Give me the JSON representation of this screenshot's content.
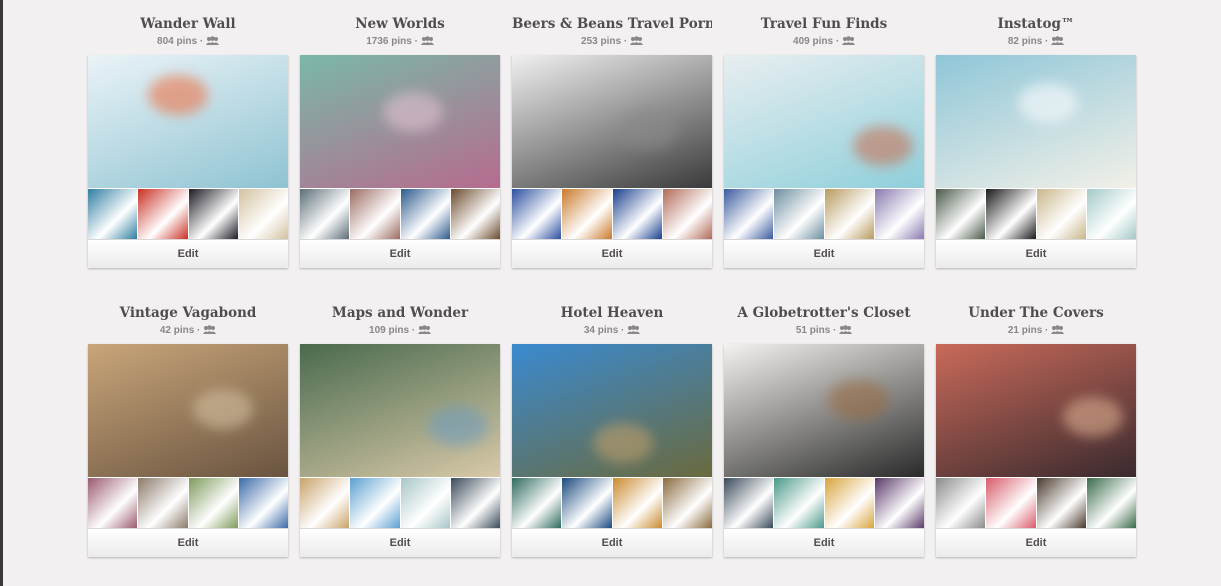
{
  "edit_label": "Edit",
  "boards": [
    {
      "title": "Wander Wall",
      "pins": "804 pins",
      "cover": [
        "#eaf3f7",
        "#8fc3d2"
      ],
      "accent": "#f06a3a",
      "thumbs": [
        "#2f7ea1",
        "#c93024",
        "#1d1a24",
        "#d3c1a0"
      ]
    },
    {
      "title": "New Worlds",
      "pins": "1736 pins",
      "cover": [
        "#7ab8a8",
        "#b66b8e"
      ],
      "accent": "#e7c6d6",
      "thumbs": [
        "#5d6e78",
        "#9c6b61",
        "#2d5a8e",
        "#6c4b2e"
      ]
    },
    {
      "title": "Beers & Beans Travel Porn",
      "pins": "253 pins",
      "cover": [
        "#f0f0f0",
        "#3a3a3a"
      ],
      "accent": "#8a8a8a",
      "thumbs": [
        "#2b4fa0",
        "#c97a2a",
        "#1a3f8e",
        "#b26a58"
      ]
    },
    {
      "title": "Travel Fun Finds",
      "pins": "409 pins",
      "cover": [
        "#e8eef0",
        "#8fcfdb"
      ],
      "accent": "#c96a4a",
      "thumbs": [
        "#3a5a9e",
        "#6c8ea0",
        "#b89a5e",
        "#8a7ab0"
      ]
    },
    {
      "title": "Instatog™",
      "pins": "82 pins",
      "cover": [
        "#8fc6d8",
        "#f2f0e8"
      ],
      "accent": "#ffffff",
      "thumbs": [
        "#4a5a4a",
        "#1a1a1a",
        "#c9b68a",
        "#a2c9c8"
      ]
    },
    {
      "title": "Vintage Vagabond",
      "pins": "42 pins",
      "cover": [
        "#c9a67a",
        "#6a5440"
      ],
      "accent": "#d8c6a8",
      "thumbs": [
        "#9a5a6e",
        "#8c7a6a",
        "#7e9a5a",
        "#3a6aa8"
      ]
    },
    {
      "title": "Maps and Wonder",
      "pins": "109 pins",
      "cover": [
        "#4a6a4e",
        "#d8c9a8"
      ],
      "accent": "#6b9bc0",
      "thumbs": [
        "#c9a26a",
        "#5aa0d0",
        "#a8c6c8",
        "#3a4a5a"
      ]
    },
    {
      "title": "Hotel Heaven",
      "pins": "34 pins",
      "cover": [
        "#3a8ad0",
        "#6a6a3e"
      ],
      "accent": "#c9a26a",
      "thumbs": [
        "#2e6a5e",
        "#1a4a7e",
        "#c98a2e",
        "#8a6a3e"
      ]
    },
    {
      "title": "A Globetrotter's Closet",
      "pins": "51 pins",
      "cover": [
        "#f4f2ee",
        "#2a2a2a"
      ],
      "accent": "#9a6a3e",
      "thumbs": [
        "#3a4a5a",
        "#4a9a8a",
        "#d8a43e",
        "#5a3a6a"
      ]
    },
    {
      "title": "Under The Covers",
      "pins": "21 pins",
      "cover": [
        "#c96a5a",
        "#3a2a2e"
      ],
      "accent": "#e8b898",
      "thumbs": [
        "#8a8a8a",
        "#d85a6a",
        "#4a3a2e",
        "#3a6a4a"
      ]
    }
  ]
}
